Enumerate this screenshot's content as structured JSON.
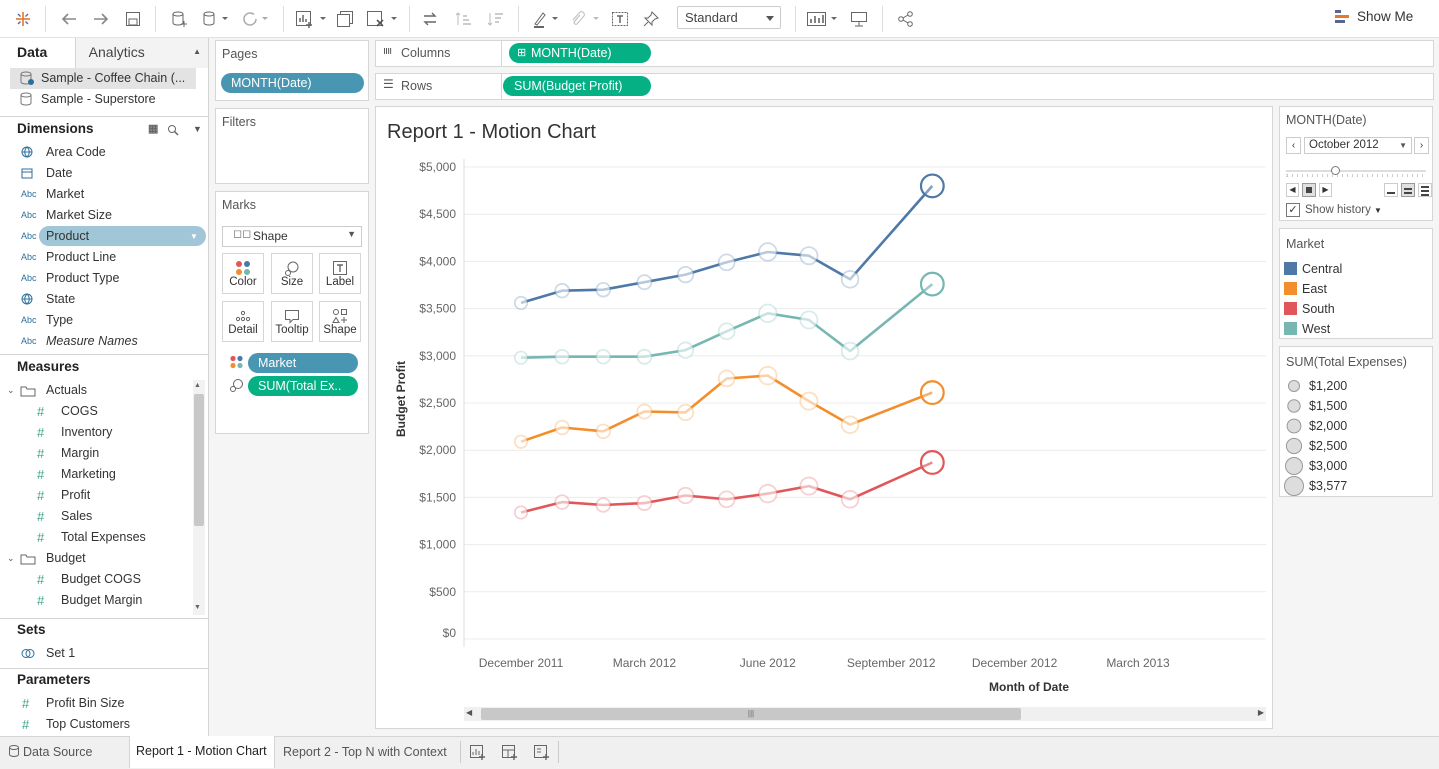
{
  "toolbar": {
    "fit_mode": "Standard",
    "show_me": "Show Me"
  },
  "left_pane": {
    "tabs": [
      "Data",
      "Analytics"
    ],
    "datasources": [
      "Sample - Coffee Chain (...",
      "Sample - Superstore"
    ],
    "dimensions_header": "Dimensions",
    "dimensions": [
      {
        "label": "Area Code",
        "icon": "globe-icon"
      },
      {
        "label": "Date",
        "icon": "calendar-icon"
      },
      {
        "label": "Market",
        "icon": "abc-icon"
      },
      {
        "label": "Market Size",
        "icon": "abc-icon"
      },
      {
        "label": "Product",
        "icon": "abc-icon"
      },
      {
        "label": "Product Line",
        "icon": "abc-icon"
      },
      {
        "label": "Product Type",
        "icon": "abc-icon"
      },
      {
        "label": "State",
        "icon": "globe-icon"
      },
      {
        "label": "Type",
        "icon": "abc-icon"
      },
      {
        "label": "Measure Names",
        "icon": "abc-icon"
      }
    ],
    "measures_header": "Measures",
    "measure_folders": [
      {
        "label": "Actuals",
        "items": [
          "COGS",
          "Inventory",
          "Margin",
          "Marketing",
          "Profit",
          "Sales",
          "Total Expenses"
        ]
      },
      {
        "label": "Budget",
        "items": [
          "Budget COGS",
          "Budget Margin"
        ]
      }
    ],
    "sets_header": "Sets",
    "sets": [
      "Set 1"
    ],
    "parameters_header": "Parameters",
    "parameters": [
      "Profit Bin Size",
      "Top Customers"
    ]
  },
  "shelves": {
    "pages_label": "Pages",
    "pages_pill": "MONTH(Date)",
    "filters_label": "Filters",
    "marks_label": "Marks",
    "mark_type": "Shape",
    "mark_buttons": [
      "Color",
      "Size",
      "Label",
      "Detail",
      "Tooltip",
      "Shape"
    ],
    "mark_pills": [
      "Market",
      "SUM(Total Ex.."
    ],
    "columns_label": "Columns",
    "columns_pill": "MONTH(Date)",
    "rows_label": "Rows",
    "rows_pill": "SUM(Budget Profit)"
  },
  "page_control": {
    "title": "MONTH(Date)",
    "value": "October 2012",
    "show_history": "Show history",
    "progress": 0.35
  },
  "color_legend": {
    "title": "Market",
    "items": [
      {
        "label": "Central",
        "color": "#4e79a7"
      },
      {
        "label": "East",
        "color": "#f28e2b"
      },
      {
        "label": "South",
        "color": "#e15759"
      },
      {
        "label": "West",
        "color": "#76b7b2"
      }
    ]
  },
  "size_legend": {
    "title": "SUM(Total Expenses)",
    "items": [
      "$1,200",
      "$1,500",
      "$2,000",
      "$2,500",
      "$3,000",
      "$3,577"
    ]
  },
  "chart_data": {
    "type": "line",
    "title": "Report 1 - Motion Chart",
    "xlabel": "Month of Date",
    "ylabel": "Budget Profit",
    "x": [
      "2011-12",
      "2012-01",
      "2012-02",
      "2012-03",
      "2012-04",
      "2012-05",
      "2012-06",
      "2012-07",
      "2012-08",
      "2012-09",
      "2012-10"
    ],
    "x_ticks": [
      "December 2011",
      "March 2012",
      "June 2012",
      "September 2012",
      "December 2012",
      "March 2013"
    ],
    "y_ticks": [
      "$5,000",
      "$4,500",
      "$4,000",
      "$3,500",
      "$3,000",
      "$2,500",
      "$2,000",
      "$1,500",
      "$1,000",
      "$500",
      "$0"
    ],
    "ylim": [
      0,
      5000
    ],
    "grid": true,
    "series": [
      {
        "name": "Central",
        "values": [
          3560,
          3690,
          3700,
          3780,
          3860,
          3990,
          4100,
          4060,
          3810,
          null,
          4800
        ]
      },
      {
        "name": "West",
        "values": [
          2980,
          2990,
          2990,
          2990,
          3060,
          3260,
          3450,
          3380,
          3050,
          null,
          3760
        ]
      },
      {
        "name": "East",
        "values": [
          2090,
          2240,
          2200,
          2410,
          2400,
          2760,
          2790,
          2520,
          2270,
          null,
          2610
        ]
      },
      {
        "name": "South",
        "values": [
          1340,
          1450,
          1420,
          1440,
          1520,
          1480,
          1540,
          1620,
          1480,
          null,
          1870
        ]
      }
    ],
    "marker_sizes": [
      1200,
      1500,
      1500,
      1600,
      1900,
      2000,
      2400,
      2300,
      2200,
      null,
      3577
    ]
  },
  "sheet_tabs": [
    "Data Source",
    "Report 1 - Motion Chart",
    "Report 2 - Top N with Context"
  ]
}
